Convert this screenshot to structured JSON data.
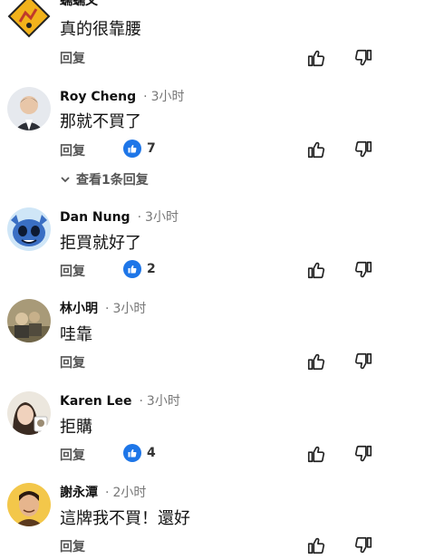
{
  "comments": [
    {
      "name": "蠕蠕文",
      "time": "",
      "text": "真的很靠腰",
      "reply": "回复",
      "likes": ""
    },
    {
      "name": "Roy Cheng",
      "time": "3小时",
      "text": "那就不買了",
      "reply": "回复",
      "likes": "7",
      "view_replies": "查看1条回复"
    },
    {
      "name": "Dan Nung",
      "time": "3小时",
      "text": "拒買就好了",
      "reply": "回复",
      "likes": "2"
    },
    {
      "name": "林小明",
      "time": "3小时",
      "text": "哇靠",
      "reply": "回复",
      "likes": ""
    },
    {
      "name": "Karen Lee",
      "time": "3小时",
      "text": "拒購",
      "reply": "回复",
      "likes": "4"
    },
    {
      "name": "謝永潭",
      "time": "2小时",
      "text": "這牌我不買！還好",
      "reply": "回复",
      "likes": ""
    }
  ],
  "dot": "·",
  "colors": {
    "like_badge": "#1e76e8"
  }
}
